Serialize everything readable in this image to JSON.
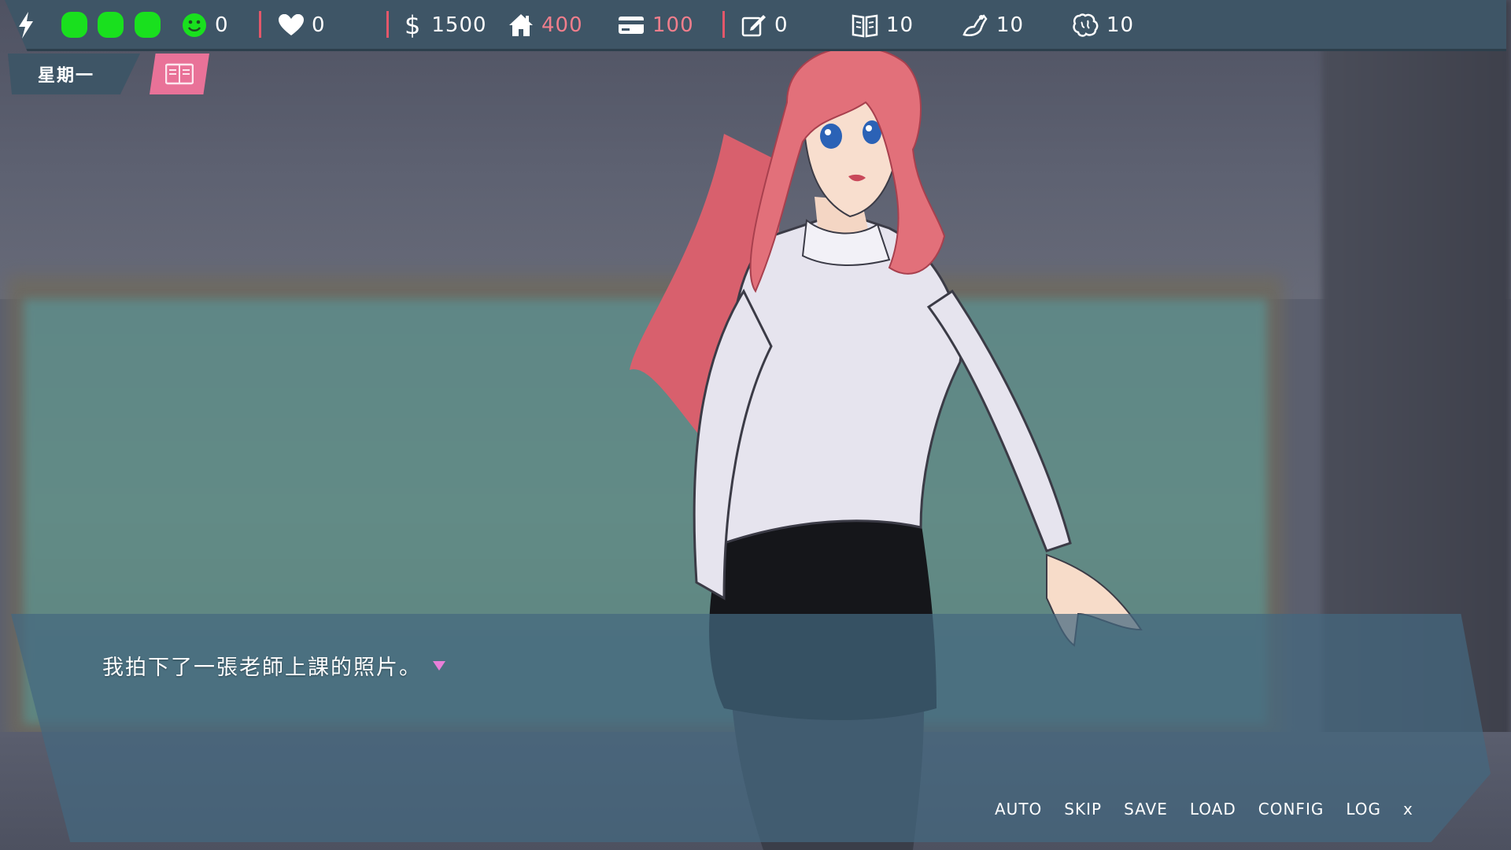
{
  "hud": {
    "energy_icon": "lightning-icon",
    "energy_pips": 3,
    "mood_value": "0",
    "affection_value": "0",
    "money_value": "1500",
    "rent_value": "400",
    "card_value": "100",
    "notes_value": "0",
    "stat1_value": "10",
    "stat2_value": "10",
    "stat3_value": "10",
    "colors": {
      "bar": "#3e5566",
      "pip": "#19e01e",
      "pink": "#f07e8c",
      "separator": "#e4576a"
    }
  },
  "day": {
    "label": "星期一"
  },
  "journal": {
    "icon": "book-icon",
    "color": "#e97298"
  },
  "dialogue": {
    "text": "我拍下了一張老師上課的照片。"
  },
  "menu": {
    "auto": "AUTO",
    "skip": "SKIP",
    "save": "SAVE",
    "load": "LOAD",
    "config": "CONFIG",
    "log": "LOG",
    "close": "x"
  }
}
